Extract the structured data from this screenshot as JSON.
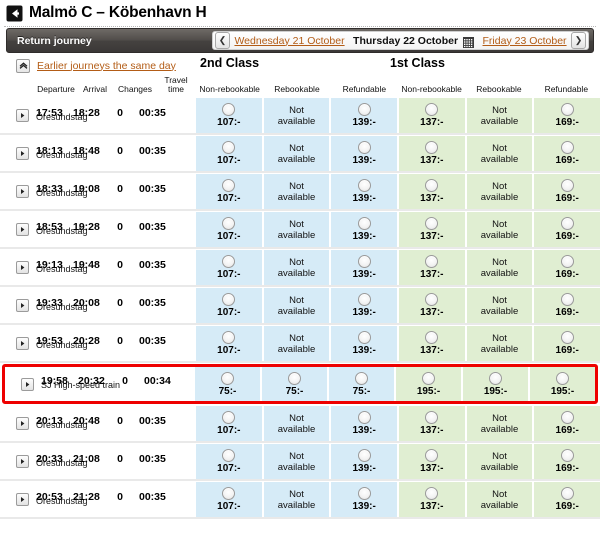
{
  "header": {
    "back_icon": "back-arrow-icon",
    "title": "Malmö C – Köbenhavn H"
  },
  "toolbar": {
    "label": "Return journey",
    "prev_arrow": "❮",
    "next_arrow": "❯",
    "prev_date": "Wednesday 21 October",
    "current_date": "Thursday 22 October",
    "next_date": "Friday 23 October",
    "calendar_icon": "calendar-icon"
  },
  "earlier": {
    "icon": "collapse-up-icon",
    "link": "Earlier journeys the same day"
  },
  "class_headers": {
    "second": "2nd Class",
    "first": "1st Class"
  },
  "columns": {
    "departure": "Departure",
    "arrival": "Arrival",
    "changes": "Changes",
    "travel_time_line1": "Travel",
    "travel_time_line2": "time",
    "fares": [
      "Non-rebookable",
      "Rebookable",
      "Refundable",
      "Non-rebookable",
      "Rebookable",
      "Refundable"
    ]
  },
  "labels": {
    "not_available_line1": "Not",
    "not_available_line2": "available"
  },
  "colors": {
    "second_class_bg": "#d6ebf7",
    "first_class_bg": "#e0eed2",
    "link": "#b35c16",
    "highlight_border": "#ee0000",
    "toolbar_bg": "#514d4a"
  },
  "journeys": [
    {
      "departure": "17:53",
      "arrival": "18:28",
      "changes": "0",
      "travel_time": "00:35",
      "train": "Öresundståg",
      "meal": false,
      "highlighted": false,
      "fares": [
        {
          "price": "107:-",
          "available": true
        },
        {
          "price": "",
          "available": false
        },
        {
          "price": "139:-",
          "available": true
        },
        {
          "price": "137:-",
          "available": true
        },
        {
          "price": "",
          "available": false
        },
        {
          "price": "169:-",
          "available": true
        }
      ]
    },
    {
      "departure": "18:13",
      "arrival": "18:48",
      "changes": "0",
      "travel_time": "00:35",
      "train": "Öresundståg",
      "meal": false,
      "highlighted": false,
      "fares": [
        {
          "price": "107:-",
          "available": true
        },
        {
          "price": "",
          "available": false
        },
        {
          "price": "139:-",
          "available": true
        },
        {
          "price": "137:-",
          "available": true
        },
        {
          "price": "",
          "available": false
        },
        {
          "price": "169:-",
          "available": true
        }
      ]
    },
    {
      "departure": "18:33",
      "arrival": "19:08",
      "changes": "0",
      "travel_time": "00:35",
      "train": "Öresundståg",
      "meal": false,
      "highlighted": false,
      "fares": [
        {
          "price": "107:-",
          "available": true
        },
        {
          "price": "",
          "available": false
        },
        {
          "price": "139:-",
          "available": true
        },
        {
          "price": "137:-",
          "available": true
        },
        {
          "price": "",
          "available": false
        },
        {
          "price": "169:-",
          "available": true
        }
      ]
    },
    {
      "departure": "18:53",
      "arrival": "19:28",
      "changes": "0",
      "travel_time": "00:35",
      "train": "Öresundståg",
      "meal": false,
      "highlighted": false,
      "fares": [
        {
          "price": "107:-",
          "available": true
        },
        {
          "price": "",
          "available": false
        },
        {
          "price": "139:-",
          "available": true
        },
        {
          "price": "137:-",
          "available": true
        },
        {
          "price": "",
          "available": false
        },
        {
          "price": "169:-",
          "available": true
        }
      ]
    },
    {
      "departure": "19:13",
      "arrival": "19:48",
      "changes": "0",
      "travel_time": "00:35",
      "train": "Öresundståg",
      "meal": false,
      "highlighted": false,
      "fares": [
        {
          "price": "107:-",
          "available": true
        },
        {
          "price": "",
          "available": false
        },
        {
          "price": "139:-",
          "available": true
        },
        {
          "price": "137:-",
          "available": true
        },
        {
          "price": "",
          "available": false
        },
        {
          "price": "169:-",
          "available": true
        }
      ]
    },
    {
      "departure": "19:33",
      "arrival": "20:08",
      "changes": "0",
      "travel_time": "00:35",
      "train": "Öresundståg",
      "meal": false,
      "highlighted": false,
      "fares": [
        {
          "price": "107:-",
          "available": true
        },
        {
          "price": "",
          "available": false
        },
        {
          "price": "139:-",
          "available": true
        },
        {
          "price": "137:-",
          "available": true
        },
        {
          "price": "",
          "available": false
        },
        {
          "price": "169:-",
          "available": true
        }
      ]
    },
    {
      "departure": "19:53",
      "arrival": "20:28",
      "changes": "0",
      "travel_time": "00:35",
      "train": "Öresundståg",
      "meal": false,
      "highlighted": false,
      "fares": [
        {
          "price": "107:-",
          "available": true
        },
        {
          "price": "",
          "available": false
        },
        {
          "price": "139:-",
          "available": true
        },
        {
          "price": "137:-",
          "available": true
        },
        {
          "price": "",
          "available": false
        },
        {
          "price": "169:-",
          "available": true
        }
      ]
    },
    {
      "departure": "19:58",
      "arrival": "20:32",
      "changes": "0",
      "travel_time": "00:34",
      "train": "SJ High-speed train",
      "meal": true,
      "highlighted": true,
      "fares": [
        {
          "price": "75:-",
          "available": true
        },
        {
          "price": "75:-",
          "available": true
        },
        {
          "price": "75:-",
          "available": true
        },
        {
          "price": "195:-",
          "available": true
        },
        {
          "price": "195:-",
          "available": true
        },
        {
          "price": "195:-",
          "available": true
        }
      ]
    },
    {
      "departure": "20:13",
      "arrival": "20:48",
      "changes": "0",
      "travel_time": "00:35",
      "train": "Öresundståg",
      "meal": false,
      "highlighted": false,
      "fares": [
        {
          "price": "107:-",
          "available": true
        },
        {
          "price": "",
          "available": false
        },
        {
          "price": "139:-",
          "available": true
        },
        {
          "price": "137:-",
          "available": true
        },
        {
          "price": "",
          "available": false
        },
        {
          "price": "169:-",
          "available": true
        }
      ]
    },
    {
      "departure": "20:33",
      "arrival": "21:08",
      "changes": "0",
      "travel_time": "00:35",
      "train": "Öresundståg",
      "meal": false,
      "highlighted": false,
      "fares": [
        {
          "price": "107:-",
          "available": true
        },
        {
          "price": "",
          "available": false
        },
        {
          "price": "139:-",
          "available": true
        },
        {
          "price": "137:-",
          "available": true
        },
        {
          "price": "",
          "available": false
        },
        {
          "price": "169:-",
          "available": true
        }
      ]
    },
    {
      "departure": "20:53",
      "arrival": "21:28",
      "changes": "0",
      "travel_time": "00:35",
      "train": "Öresundståg",
      "meal": false,
      "highlighted": false,
      "fares": [
        {
          "price": "107:-",
          "available": true
        },
        {
          "price": "",
          "available": false
        },
        {
          "price": "139:-",
          "available": true
        },
        {
          "price": "137:-",
          "available": true
        },
        {
          "price": "",
          "available": false
        },
        {
          "price": "169:-",
          "available": true
        }
      ]
    }
  ]
}
